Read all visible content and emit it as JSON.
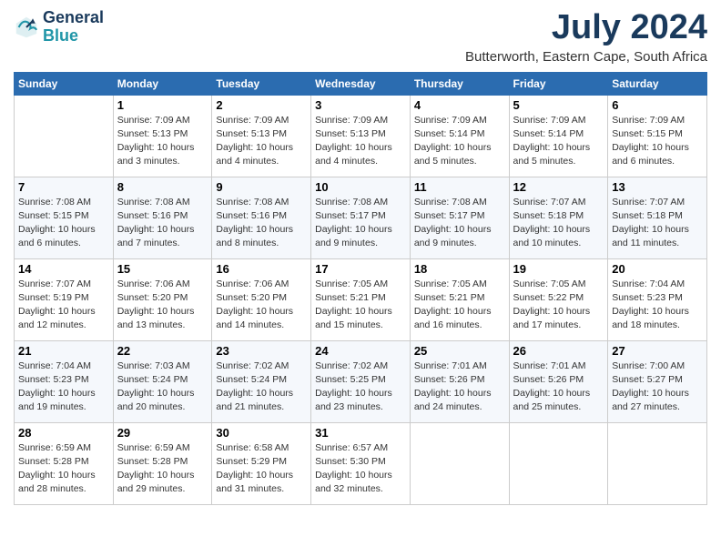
{
  "logo": {
    "line1": "General",
    "line2": "Blue"
  },
  "title": "July 2024",
  "location": "Butterworth, Eastern Cape, South Africa",
  "headers": [
    "Sunday",
    "Monday",
    "Tuesday",
    "Wednesday",
    "Thursday",
    "Friday",
    "Saturday"
  ],
  "weeks": [
    [
      {
        "day": "",
        "sunrise": "",
        "sunset": "",
        "daylight": ""
      },
      {
        "day": "1",
        "sunrise": "Sunrise: 7:09 AM",
        "sunset": "Sunset: 5:13 PM",
        "daylight": "Daylight: 10 hours and 3 minutes."
      },
      {
        "day": "2",
        "sunrise": "Sunrise: 7:09 AM",
        "sunset": "Sunset: 5:13 PM",
        "daylight": "Daylight: 10 hours and 4 minutes."
      },
      {
        "day": "3",
        "sunrise": "Sunrise: 7:09 AM",
        "sunset": "Sunset: 5:13 PM",
        "daylight": "Daylight: 10 hours and 4 minutes."
      },
      {
        "day": "4",
        "sunrise": "Sunrise: 7:09 AM",
        "sunset": "Sunset: 5:14 PM",
        "daylight": "Daylight: 10 hours and 5 minutes."
      },
      {
        "day": "5",
        "sunrise": "Sunrise: 7:09 AM",
        "sunset": "Sunset: 5:14 PM",
        "daylight": "Daylight: 10 hours and 5 minutes."
      },
      {
        "day": "6",
        "sunrise": "Sunrise: 7:09 AM",
        "sunset": "Sunset: 5:15 PM",
        "daylight": "Daylight: 10 hours and 6 minutes."
      }
    ],
    [
      {
        "day": "7",
        "sunrise": "Sunrise: 7:08 AM",
        "sunset": "Sunset: 5:15 PM",
        "daylight": "Daylight: 10 hours and 6 minutes."
      },
      {
        "day": "8",
        "sunrise": "Sunrise: 7:08 AM",
        "sunset": "Sunset: 5:16 PM",
        "daylight": "Daylight: 10 hours and 7 minutes."
      },
      {
        "day": "9",
        "sunrise": "Sunrise: 7:08 AM",
        "sunset": "Sunset: 5:16 PM",
        "daylight": "Daylight: 10 hours and 8 minutes."
      },
      {
        "day": "10",
        "sunrise": "Sunrise: 7:08 AM",
        "sunset": "Sunset: 5:17 PM",
        "daylight": "Daylight: 10 hours and 9 minutes."
      },
      {
        "day": "11",
        "sunrise": "Sunrise: 7:08 AM",
        "sunset": "Sunset: 5:17 PM",
        "daylight": "Daylight: 10 hours and 9 minutes."
      },
      {
        "day": "12",
        "sunrise": "Sunrise: 7:07 AM",
        "sunset": "Sunset: 5:18 PM",
        "daylight": "Daylight: 10 hours and 10 minutes."
      },
      {
        "day": "13",
        "sunrise": "Sunrise: 7:07 AM",
        "sunset": "Sunset: 5:18 PM",
        "daylight": "Daylight: 10 hours and 11 minutes."
      }
    ],
    [
      {
        "day": "14",
        "sunrise": "Sunrise: 7:07 AM",
        "sunset": "Sunset: 5:19 PM",
        "daylight": "Daylight: 10 hours and 12 minutes."
      },
      {
        "day": "15",
        "sunrise": "Sunrise: 7:06 AM",
        "sunset": "Sunset: 5:20 PM",
        "daylight": "Daylight: 10 hours and 13 minutes."
      },
      {
        "day": "16",
        "sunrise": "Sunrise: 7:06 AM",
        "sunset": "Sunset: 5:20 PM",
        "daylight": "Daylight: 10 hours and 14 minutes."
      },
      {
        "day": "17",
        "sunrise": "Sunrise: 7:05 AM",
        "sunset": "Sunset: 5:21 PM",
        "daylight": "Daylight: 10 hours and 15 minutes."
      },
      {
        "day": "18",
        "sunrise": "Sunrise: 7:05 AM",
        "sunset": "Sunset: 5:21 PM",
        "daylight": "Daylight: 10 hours and 16 minutes."
      },
      {
        "day": "19",
        "sunrise": "Sunrise: 7:05 AM",
        "sunset": "Sunset: 5:22 PM",
        "daylight": "Daylight: 10 hours and 17 minutes."
      },
      {
        "day": "20",
        "sunrise": "Sunrise: 7:04 AM",
        "sunset": "Sunset: 5:23 PM",
        "daylight": "Daylight: 10 hours and 18 minutes."
      }
    ],
    [
      {
        "day": "21",
        "sunrise": "Sunrise: 7:04 AM",
        "sunset": "Sunset: 5:23 PM",
        "daylight": "Daylight: 10 hours and 19 minutes."
      },
      {
        "day": "22",
        "sunrise": "Sunrise: 7:03 AM",
        "sunset": "Sunset: 5:24 PM",
        "daylight": "Daylight: 10 hours and 20 minutes."
      },
      {
        "day": "23",
        "sunrise": "Sunrise: 7:02 AM",
        "sunset": "Sunset: 5:24 PM",
        "daylight": "Daylight: 10 hours and 21 minutes."
      },
      {
        "day": "24",
        "sunrise": "Sunrise: 7:02 AM",
        "sunset": "Sunset: 5:25 PM",
        "daylight": "Daylight: 10 hours and 23 minutes."
      },
      {
        "day": "25",
        "sunrise": "Sunrise: 7:01 AM",
        "sunset": "Sunset: 5:26 PM",
        "daylight": "Daylight: 10 hours and 24 minutes."
      },
      {
        "day": "26",
        "sunrise": "Sunrise: 7:01 AM",
        "sunset": "Sunset: 5:26 PM",
        "daylight": "Daylight: 10 hours and 25 minutes."
      },
      {
        "day": "27",
        "sunrise": "Sunrise: 7:00 AM",
        "sunset": "Sunset: 5:27 PM",
        "daylight": "Daylight: 10 hours and 27 minutes."
      }
    ],
    [
      {
        "day": "28",
        "sunrise": "Sunrise: 6:59 AM",
        "sunset": "Sunset: 5:28 PM",
        "daylight": "Daylight: 10 hours and 28 minutes."
      },
      {
        "day": "29",
        "sunrise": "Sunrise: 6:59 AM",
        "sunset": "Sunset: 5:28 PM",
        "daylight": "Daylight: 10 hours and 29 minutes."
      },
      {
        "day": "30",
        "sunrise": "Sunrise: 6:58 AM",
        "sunset": "Sunset: 5:29 PM",
        "daylight": "Daylight: 10 hours and 31 minutes."
      },
      {
        "day": "31",
        "sunrise": "Sunrise: 6:57 AM",
        "sunset": "Sunset: 5:30 PM",
        "daylight": "Daylight: 10 hours and 32 minutes."
      },
      {
        "day": "",
        "sunrise": "",
        "sunset": "",
        "daylight": ""
      },
      {
        "day": "",
        "sunrise": "",
        "sunset": "",
        "daylight": ""
      },
      {
        "day": "",
        "sunrise": "",
        "sunset": "",
        "daylight": ""
      }
    ]
  ]
}
